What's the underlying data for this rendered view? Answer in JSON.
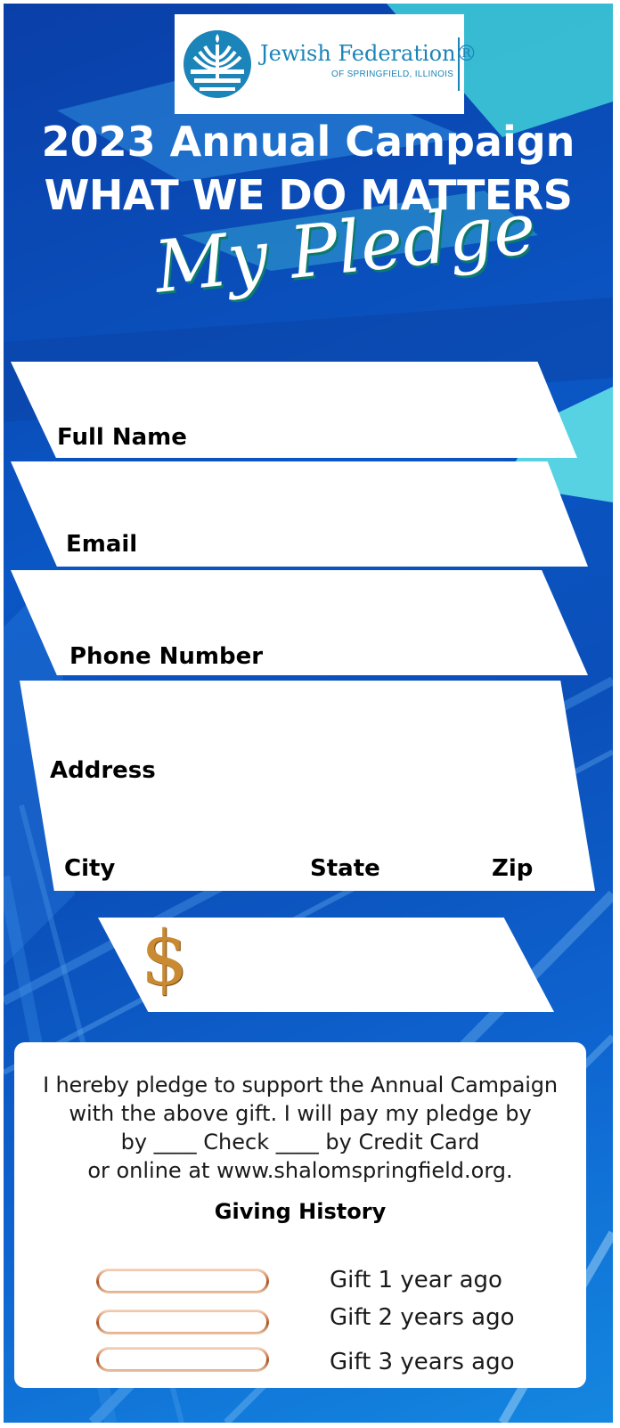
{
  "logo": {
    "name": "Jewish Federation®",
    "subtitle": "OF SPRINGFIELD, ILLINOIS"
  },
  "header": {
    "line1": "2023 Annual Campaign",
    "line2": "WHAT WE DO MATTERS",
    "script": "My Pledge"
  },
  "form": {
    "full_name_label": "Full Name",
    "email_label": "Email",
    "phone_label": "Phone Number",
    "address_label": "Address",
    "city_label": "City",
    "state_label": "State",
    "zip_label": "Zip",
    "amount_symbol": "$"
  },
  "pledge": {
    "line1": "I hereby pledge to support the Annual Campaign",
    "line2": "with the above gift.  I will pay my pledge by",
    "line3": "by ____ Check  ____ by Credit Card",
    "line4": "or online at www.shalomspringfield.org.",
    "giving_history_title": "Giving History",
    "gifts": [
      {
        "label": "Gift 1 year ago"
      },
      {
        "label": "Gift 2 years ago"
      },
      {
        "label": "Gift 3 years ago"
      }
    ]
  },
  "colors": {
    "background_primary": "#0a56c4",
    "accent_teal": "#3fd0d8",
    "logo_blue": "#1b84b8",
    "dollar_gold": "#c98a32",
    "pill_copper": "#c76a3a"
  },
  "icons": {
    "logo_mark": "menorah-circle-icon",
    "amount": "dollar-sign-icon"
  }
}
